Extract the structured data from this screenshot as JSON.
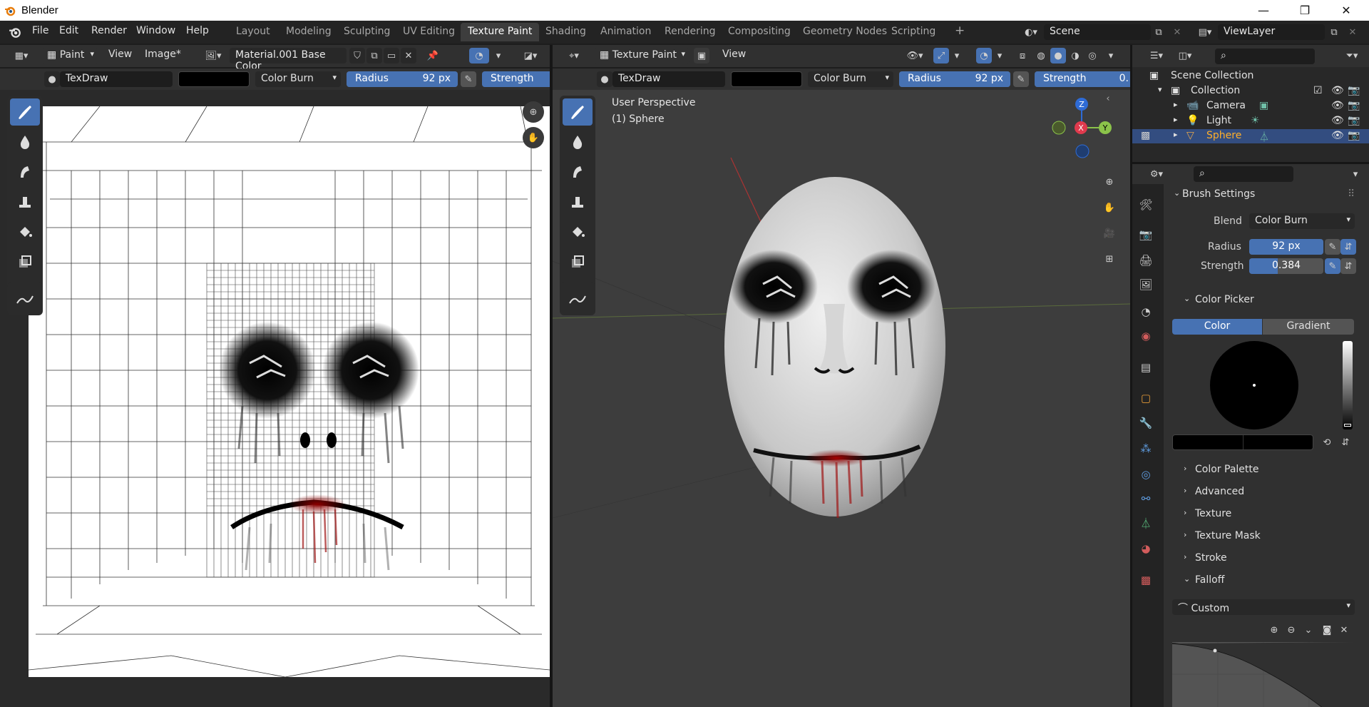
{
  "os": {
    "title": "Blender",
    "controls": [
      "—",
      "❐",
      "✕"
    ]
  },
  "menu": [
    "File",
    "Edit",
    "Render",
    "Window",
    "Help"
  ],
  "workspaces": [
    "Layout",
    "Modeling",
    "Sculpting",
    "UV Editing",
    "Texture Paint",
    "Shading",
    "Animation",
    "Rendering",
    "Compositing",
    "Geometry Nodes",
    "Scripting"
  ],
  "active_workspace": "Texture Paint",
  "add_workspace": "+",
  "scene": {
    "name": "Scene",
    "view_layer": "ViewLayer"
  },
  "image_editor": {
    "mode": "Paint",
    "menus": [
      "View",
      "Image*"
    ],
    "image_name": "Material.001 Base Color",
    "brush": "TexDraw",
    "blend": "Color Burn",
    "radius_label": "Radius",
    "radius_value": "92 px",
    "strength_label": "Strength",
    "strength_fill": 0.384
  },
  "viewport": {
    "mode": "Texture Paint",
    "menu": "View",
    "brush": "TexDraw",
    "blend": "Color Burn",
    "radius_label": "Radius",
    "radius_value": "92 px",
    "strength_label": "Strength",
    "strength_value": "0.",
    "strength_fill": 0.384,
    "info_line1": "User Perspective",
    "info_line2": "(1) Sphere",
    "gizmo": {
      "z": "Z",
      "x": "X",
      "y": "Y"
    }
  },
  "outliner": {
    "root": "Scene Collection",
    "collection": "Collection",
    "items": [
      {
        "name": "Camera",
        "color": "#e0e0e0"
      },
      {
        "name": "Light",
        "color": "#e0e0e0"
      },
      {
        "name": "Sphere",
        "color": "#ffaf29"
      }
    ]
  },
  "properties": {
    "brush_settings": "Brush Settings",
    "blend_label": "Blend",
    "blend_value": "Color Burn",
    "radius_label": "Radius",
    "radius_value": "92 px",
    "strength_label": "Strength",
    "strength_value": "0.384",
    "color_picker": "Color Picker",
    "color_tab": "Color",
    "gradient_tab": "Gradient",
    "collapsed_panels": [
      "Color Palette",
      "Advanced",
      "Texture",
      "Texture Mask",
      "Stroke"
    ],
    "falloff": "Falloff",
    "falloff_preset": "Custom"
  },
  "colors": {
    "accent": "#4772b3",
    "selected_row": "#334d80",
    "header": "#303030",
    "orange": "#ffaf29"
  }
}
